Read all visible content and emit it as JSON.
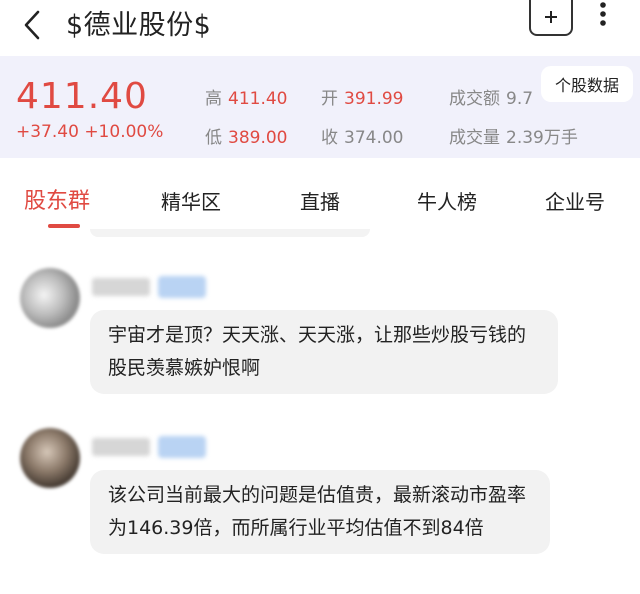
{
  "header": {
    "title": "$德业股份$",
    "add_label": "+"
  },
  "quote": {
    "price": "411.40",
    "change": "+37.40 +10.00%",
    "high_label": "高",
    "high_value": "411.40",
    "open_label": "开",
    "open_value": "391.99",
    "turnover_label": "成交额",
    "turnover_value": "9.7",
    "low_label": "低",
    "low_value": "389.00",
    "close_label": "收",
    "close_value": "374.00",
    "volume_label": "成交量",
    "volume_value": "2.39万手",
    "stock_data_button": "个股数据",
    "colors": {
      "up": "#e04a42",
      "panel_bg": "#f1f1fb"
    }
  },
  "tabs": [
    {
      "label": "股东群",
      "active": true
    },
    {
      "label": "精华区",
      "active": false
    },
    {
      "label": "直播",
      "active": false
    },
    {
      "label": "牛人榜",
      "active": false
    },
    {
      "label": "企业号",
      "active": false
    }
  ],
  "posts": [
    {
      "text": "宇宙才是顶？天天涨、天天涨，让那些炒股亏钱的股民羡慕嫉妒恨啊"
    },
    {
      "text": "该公司当前最大的问题是估值贵，最新滚动市盈率为146.39倍，而所属行业平均估值不到84倍"
    }
  ]
}
